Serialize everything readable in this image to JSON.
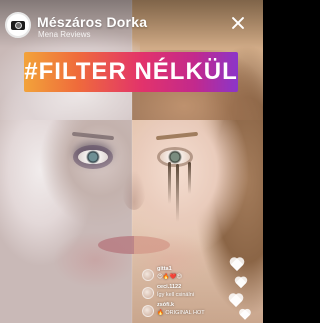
{
  "header": {
    "user_name": "Mészáros Dorka",
    "user_subtitle": "Mena Reviews"
  },
  "banner": {
    "hashtag": "#FILTER NÉLKÜL",
    "gradient": [
      "#f2a33a",
      "#ef6b3b",
      "#e2336b",
      "#c2298d",
      "#8b35c9"
    ]
  },
  "comments": [
    {
      "user": "gitta1",
      "text": "😍🔥❤️😍"
    },
    {
      "user": "ceci.1122",
      "text": "Így kell csinálni"
    },
    {
      "user": "zsófi.k",
      "text": "🔥 ORIGINAL HOT"
    }
  ],
  "icons": {
    "avatar": "camera-icon",
    "close": "close-icon",
    "reaction": "heart-icon"
  }
}
